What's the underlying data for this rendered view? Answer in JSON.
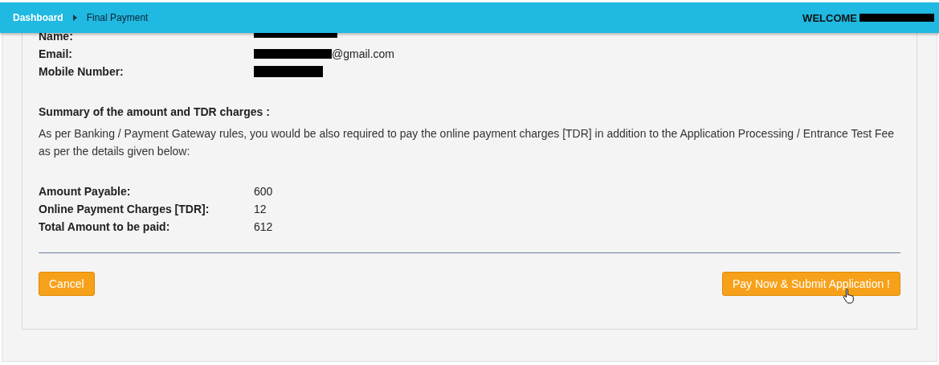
{
  "breadcrumb": [
    {
      "label": "Dashboard",
      "current": false
    },
    {
      "label": "Final Payment",
      "current": true
    }
  ],
  "welcome": "WELCOME",
  "contact": [
    {
      "label": "Name:"
    },
    {
      "label": "Email:",
      "value": "@gmail.com"
    },
    {
      "label": "Mobile Number:"
    }
  ],
  "summary": {
    "heading": "Summary of the amount and TDR charges :",
    "text": "As per Banking / Payment Gateway rules, you would be also required to pay the online payment charges [TDR] in addition to the Application Processing / Entrance Test Fee as per the details given below:"
  },
  "amounts": [
    {
      "label": "Amount Payable:",
      "value": "600"
    },
    {
      "label": "Online Payment Charges [TDR]:",
      "value": "12"
    },
    {
      "label": "Total Amount to be paid:",
      "value": "612"
    }
  ],
  "buttons": {
    "cancel": "Cancel",
    "submit": "Pay Now & Submit Application !"
  }
}
